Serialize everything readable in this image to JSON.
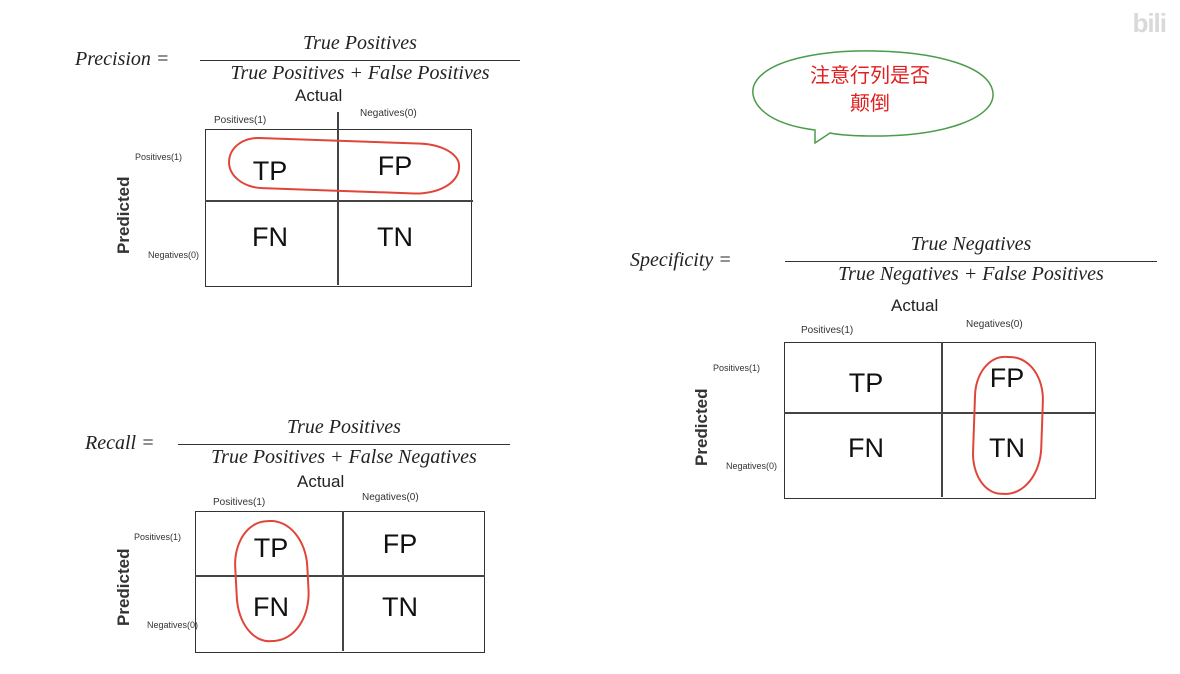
{
  "watermark": "bili",
  "note": {
    "line1": "注意行列是否",
    "line2": "颠倒",
    "color": "#e02020"
  },
  "precision": {
    "lhs": "Precision =",
    "numerator": "True Positives",
    "denominator": "True Positives + False Positives"
  },
  "recall": {
    "lhs": "Recall =",
    "numerator": "True Positives",
    "denominator": "True Positives + False Negatives"
  },
  "specificity": {
    "lhs": "Specificity =",
    "numerator": "True Negatives",
    "denominator": "True Negatives + False Positives"
  },
  "matrix": {
    "actual": "Actual",
    "predicted": "Predicted",
    "col_pos": "Positives(1)",
    "col_neg": "Negatives(0)",
    "row_pos": "Positives(1)",
    "row_neg": "Negatives(0)",
    "tp": "TP",
    "fp": "FP",
    "fn": "FN",
    "tn": "TN"
  },
  "highlight_color": "#e0453a"
}
